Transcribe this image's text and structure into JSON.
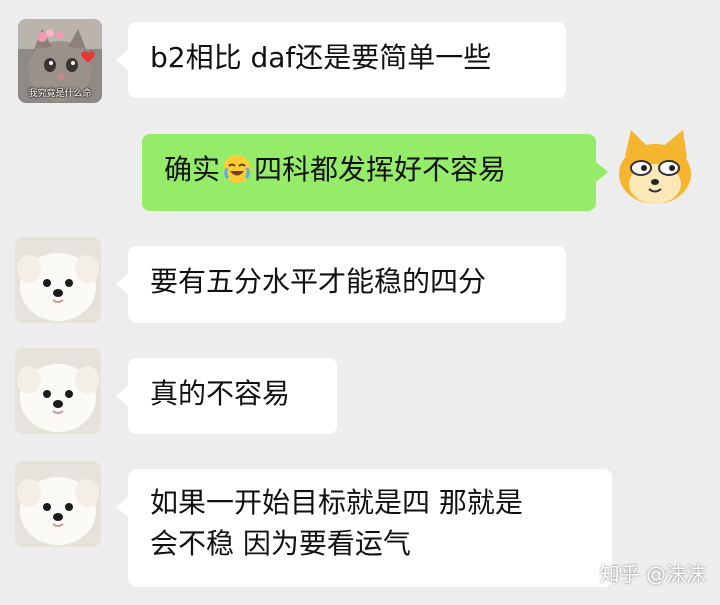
{
  "messages": [
    {
      "sender": "cat",
      "direction": "incoming",
      "avatar_caption": "我究竟是什么命",
      "text": "b2相比 daf还是要简单一些"
    },
    {
      "sender": "doge",
      "direction": "outgoing",
      "text_before": "确实",
      "emoji": "crying-laughing-emoji",
      "text_after": "四科都发挥好不容易"
    },
    {
      "sender": "puppy",
      "direction": "incoming",
      "text": "要有五分水平才能稳的四分"
    },
    {
      "sender": "puppy",
      "direction": "incoming",
      "text": "真的不容易"
    },
    {
      "sender": "puppy",
      "direction": "incoming",
      "text_line1": "如果一开始目标就是四 那就是",
      "text_line2": "会不稳 因为要看运气"
    }
  ],
  "watermark": "知乎 @沫沫",
  "colors": {
    "background": "#ededed",
    "incoming_bubble": "#ffffff",
    "outgoing_bubble": "#95ec69"
  }
}
